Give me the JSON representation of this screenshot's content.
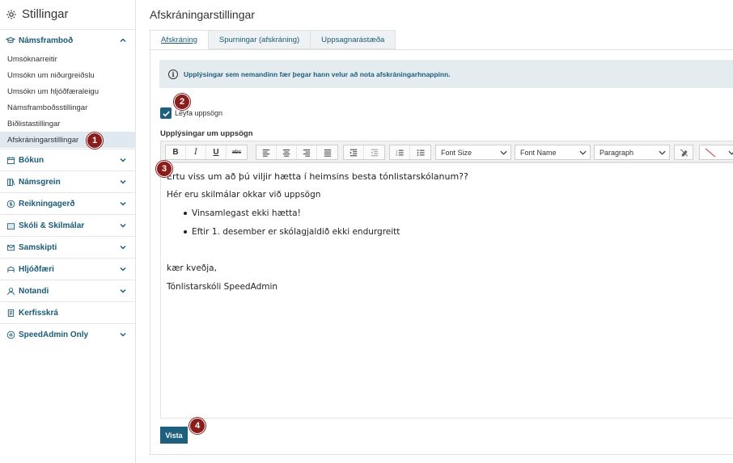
{
  "sidebar": {
    "title": "Stillingar",
    "groups": [
      {
        "label": "Námsframboð",
        "icon": "graduation-cap-icon",
        "expanded": true
      },
      {
        "label": "Bókun",
        "icon": "calendar-icon"
      },
      {
        "label": "Námsgrein",
        "icon": "books-icon"
      },
      {
        "label": "Reikningagerð",
        "icon": "dollar-circle-icon"
      },
      {
        "label": "Skóli & Skilmálar",
        "icon": "building-icon"
      },
      {
        "label": "Samskipti",
        "icon": "envelope-icon"
      },
      {
        "label": "Hljóðfæri",
        "icon": "instrument-icon"
      },
      {
        "label": "Notandi",
        "icon": "user-icon"
      },
      {
        "label": "Kerfisskrá",
        "icon": "log-file-icon"
      },
      {
        "label": "SpeedAdmin Only",
        "icon": "gear-circle-icon"
      }
    ],
    "subitems": [
      {
        "label": "Umsóknarreitir"
      },
      {
        "label": "Umsókn um niðurgreiðslu"
      },
      {
        "label": "Umsókn um hljóðfæraleigu"
      },
      {
        "label": "Námsframboðsstillingar"
      },
      {
        "label": "Biðlistastillingar"
      },
      {
        "label": "Afskráningarstillingar",
        "active": true
      }
    ]
  },
  "page_title": "Afskráningarstillingar",
  "tabs": [
    {
      "label": "Afskráning",
      "active": true
    },
    {
      "label": "Spurningar (afskráning)"
    },
    {
      "label": "Uppsagnarástæða"
    }
  ],
  "info_text": "Upplýsingar sem nemandinn fær þegar hann velur að nota afskráningarhnappinn.",
  "checkbox": {
    "label": "Leyfa uppsögn",
    "checked": true
  },
  "editor_label": "Upplýsingar um uppsögn",
  "toolbar": {
    "bold": "B",
    "italic": "I",
    "underline": "U",
    "strike": "abc",
    "font_size": "Font Size",
    "font_name": "Font Name",
    "format": "Paragraph"
  },
  "editor": {
    "line1": "Ertu viss um að þú viljir hætta í heimsins besta tónlistarskólanum??",
    "line2": "Hér eru skilmálar okkar við uppsögn",
    "bullets": [
      "Vinsamlegast ekki hætta!",
      "Eftir 1. desember er skólagjaldið ekki endurgreitt"
    ],
    "closing": "kær kveðja,",
    "signature": "Tónlistarskóli SpeedAdmin"
  },
  "save_label": "Vista",
  "markers": [
    "1",
    "2",
    "3",
    "4"
  ],
  "colors": {
    "accent": "#1e5f7d",
    "marker": "#8a1c1c",
    "info_bg": "#e4ecef"
  }
}
